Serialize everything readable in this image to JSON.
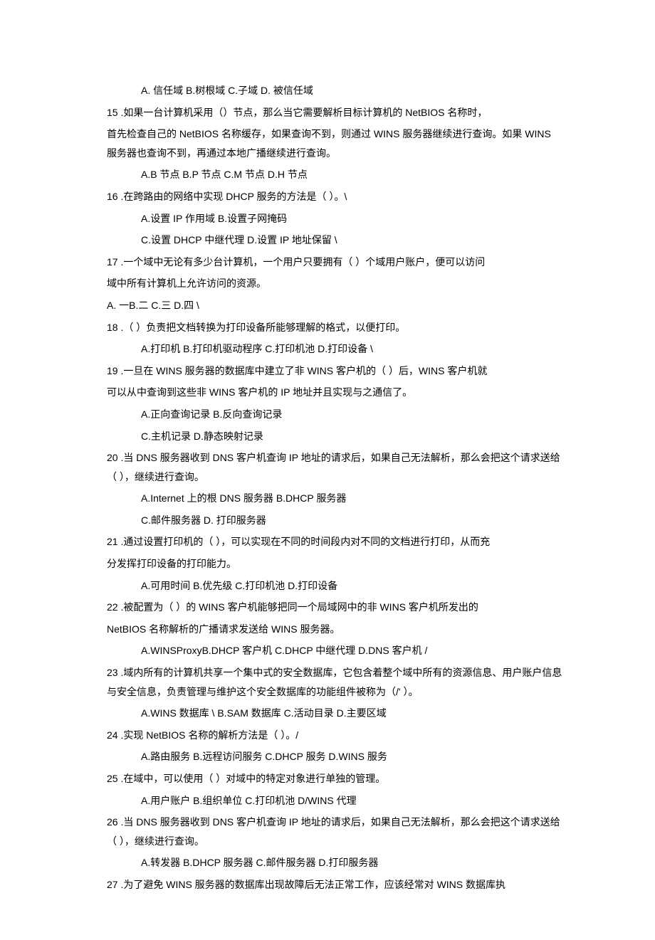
{
  "lines": [
    {
      "class": "para indent",
      "text": "A. 信任域 B.树根域 C.子域 D. 被信任域"
    },
    {
      "class": "para",
      "text": "15 .如果一台计算机采用（）节点，那么当它需要解析目标计算机的 NetBIOS 名称时，"
    },
    {
      "class": "para",
      "text": "首先检查自己的 NetBIOS 名称缓存，如果查询不到，则通过 WINS 服务器继续进行查询。如果 WINS 服务器也查询不到，再通过本地广播继续进行查询。"
    },
    {
      "class": "para indent",
      "text": "A.B 节点 B.P 节点 C.M 节点 D.H 节点"
    },
    {
      "class": "para",
      "text": "16 .在跨路由的网络中实现 DHCP 服务的方法是（ ）。\\"
    },
    {
      "class": "para indent",
      "text": "A.设置 IP 作用域 B.设置子网掩码"
    },
    {
      "class": "para indent",
      "text": "C.设置 DHCP 中继代理 D.设置 IP 地址保留 \\"
    },
    {
      "class": "para",
      "text": "17 .一个域中无论有多少台计算机，一个用户只要拥有（ ）个域用户账户，便可以访问"
    },
    {
      "class": "para",
      "text": "域中所有计算机上允许访问的资源。"
    },
    {
      "class": "para",
      "text": "A. 一B.二 C.三 D.四 \\"
    },
    {
      "class": "para",
      "text": "18 .（ ）负责把文档转换为打印设备所能够理解的格式，以便打印。"
    },
    {
      "class": "para indent",
      "text": "A.打印机 B.打印机驱动程序 C.打印机池 D.打印设备 \\"
    },
    {
      "class": "para",
      "text": "19 .一旦在 WINS 服务器的数据库中建立了非 WINS 客户机的（ ）后，WINS 客户机就"
    },
    {
      "class": "para",
      "text": "可以从中查询到这些非 WINS 客户机的 IP 地址并且实现与之通信了。"
    },
    {
      "class": "para indent",
      "text": "A.正向查询记录 B.反向查询记录"
    },
    {
      "class": "para indent",
      "text": "C.主机记录 D.静态映射记录"
    },
    {
      "class": "para",
      "text": "20 .当 DNS 服务器收到 DNS 客户机查询 IP 地址的请求后，如果自己无法解析，那么会把这个请求送给（ ），继续进行查询。"
    },
    {
      "class": "para indent",
      "text": "A.Internet 上的根 DNS 服务器 B.DHCP 服务器"
    },
    {
      "class": "para indent",
      "text": "C.邮件服务器 D. 打印服务器"
    },
    {
      "class": "para",
      "text": "21 .通过设置打印机的（ ），可以实现在不同的时间段内对不同的文档进行打印，从而充"
    },
    {
      "class": "para",
      "text": "分发挥打印设备的打印能力。"
    },
    {
      "class": "para indent",
      "text": "A.可用时间 B.优先级 C.打印机池 D.打印设备"
    },
    {
      "class": "para",
      "text": "22 .被配置为（ ）的 WINS 客户机能够把同一个局域网中的非 WINS 客户机所发出的"
    },
    {
      "class": "para",
      "text": "NetBIOS 名称解析的广播请求发送给 WINS 服务器。"
    },
    {
      "class": "para indent",
      "text": "A.WINSProxyB.DHCP 客户机 C.DHCP 中继代理 D.DNS 客户机 /"
    },
    {
      "class": "para",
      "text": "23 .域内所有的计算机共享一个集中式的安全数据库，它包含着整个域中所有的资源信息、用户账户信息与安全信息，负责管理与维护这个安全数据库的功能组件被称为（/' ）。"
    },
    {
      "class": "para indent",
      "text": "A.WINS 数据库 \\ B.SAM 数据库 C.活动目录 D.主要区域"
    },
    {
      "class": "para",
      "text": "24 .实现 NetBIOS 名称的解析方法是（ ）。/"
    },
    {
      "class": "para indent",
      "text": "A.路由服务 B.远程访问服务 C.DHCP 服务 D.WINS 服务"
    },
    {
      "class": "para",
      "text": "25 .在域中，可以使用（ ）对域中的特定对象进行单独的管理。"
    },
    {
      "class": "para indent",
      "text": "A.用户账户 B.组织单位 C.打印机池 D/WINS 代理"
    },
    {
      "class": "para",
      "text": "26 .当 DNS 服务器收到 DNS 客户机查询 IP 地址的请求后，如果自己无法解析，那么会把这个请求送给（ ），继续进行查询。"
    },
    {
      "class": "para indent",
      "text": "A.转发器 B.DHCP 服务器 C.邮件服务器 D.打印服务器"
    },
    {
      "class": "para",
      "text": "27 .为了避免 WINS 服务器的数据库出现故障后无法正常工作，应该经常对 WINS 数据库执"
    }
  ]
}
